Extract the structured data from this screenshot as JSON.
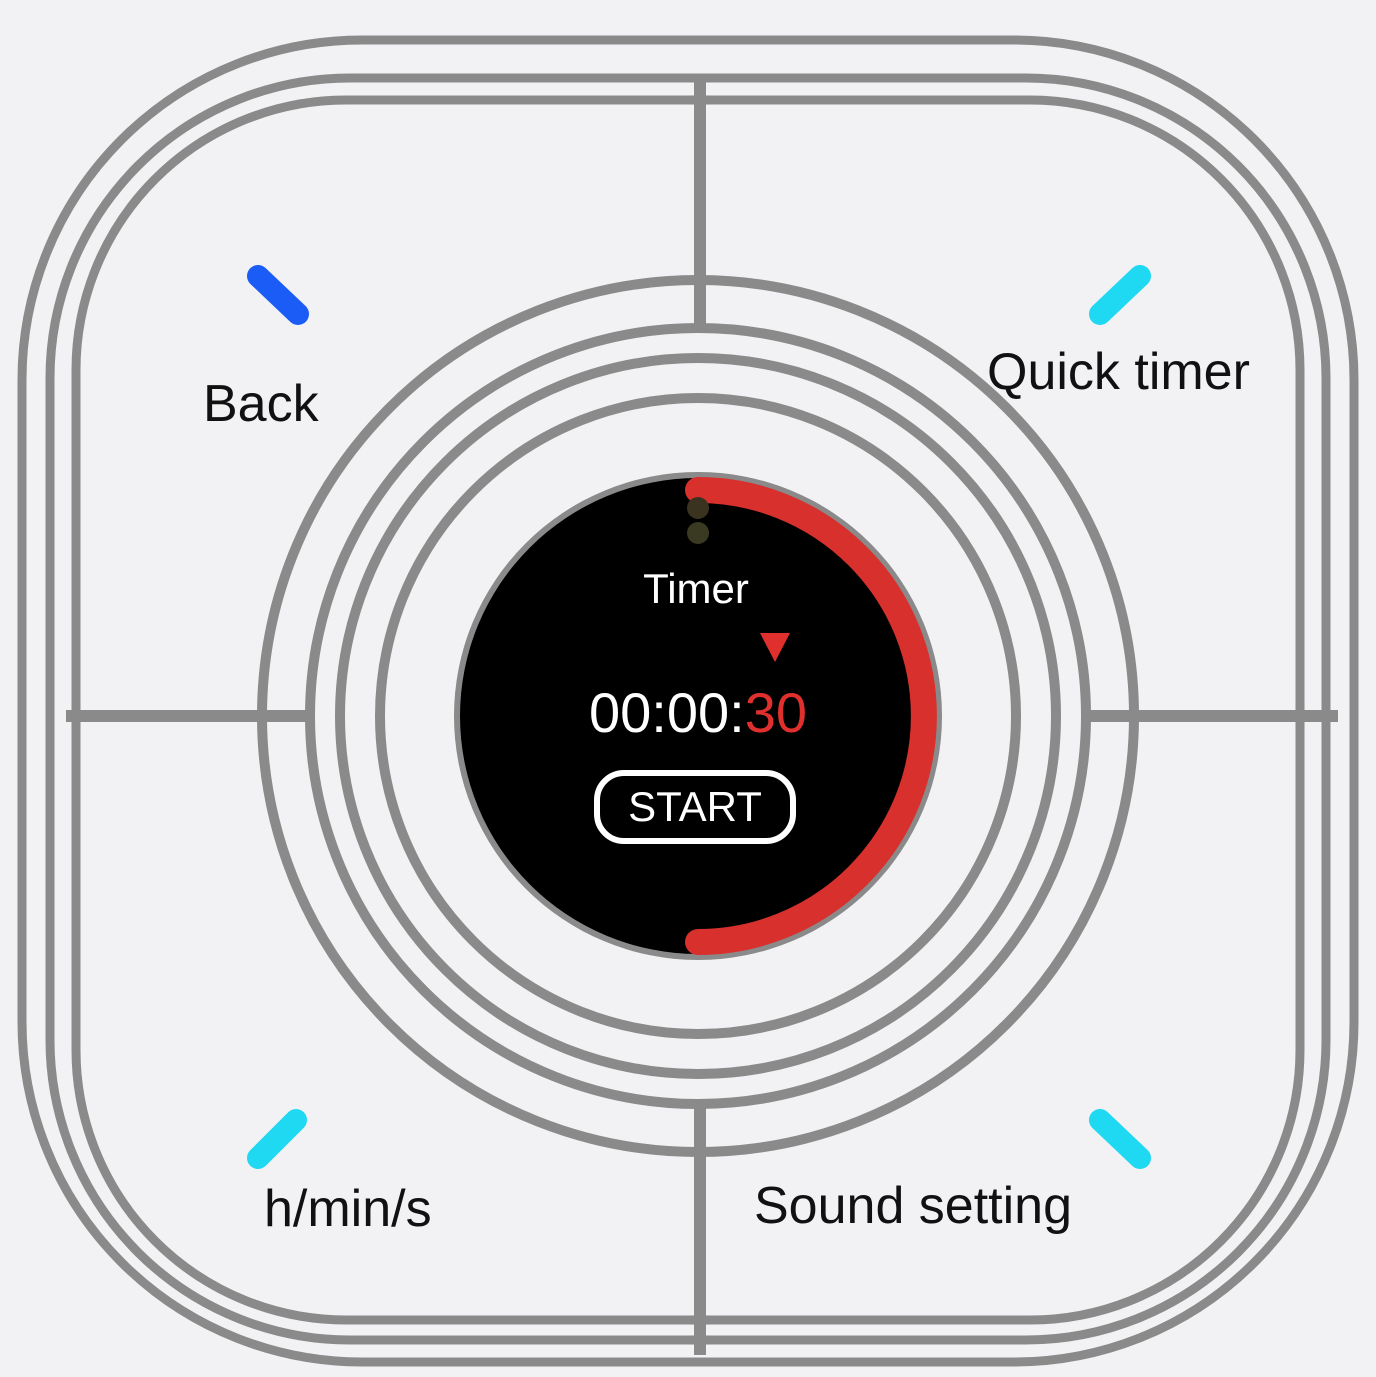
{
  "buttons": {
    "top_left_label": "Back",
    "top_right_label": "Quick timer",
    "bottom_left_label": "h/min/s",
    "bottom_right_label": "Sound setting"
  },
  "screen": {
    "title": "Timer",
    "time_prefix": "00:00:",
    "time_seconds": "30",
    "start_label": "START",
    "progress_fraction": 0.5
  },
  "colors": {
    "background": "#f2f2f5",
    "outline": "#8a8a8a",
    "back_indicator": "#1a5cf5",
    "other_indicators": "#1fd8f2",
    "accent_red": "#e0302e",
    "screen_bg": "#000000"
  },
  "icons": {
    "back_indicator": "blue-dash-indicator",
    "other_indicators": "cyan-dash-indicator",
    "screen_marker": "red-triangle-marker"
  }
}
